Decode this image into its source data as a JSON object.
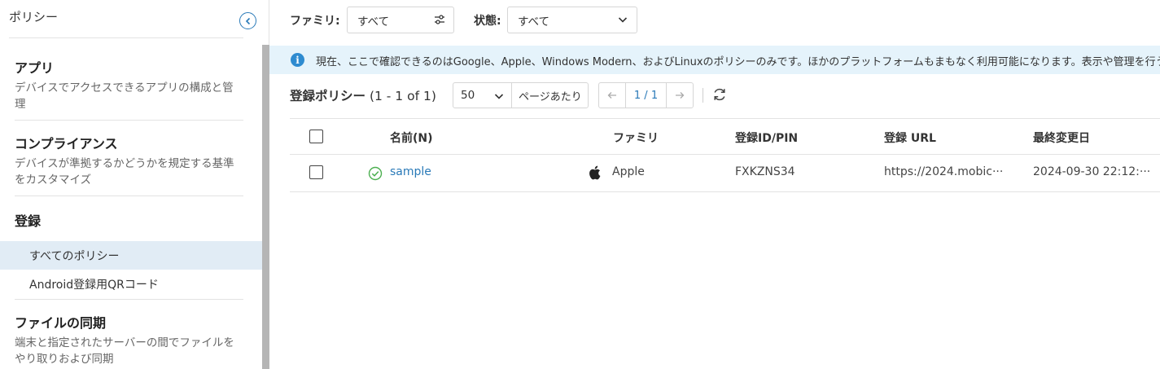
{
  "sidebar": {
    "title": "ポリシー",
    "sections": [
      {
        "title": "アプリ",
        "desc_line1": "デバイスでアクセスできるアプリの構成と管",
        "desc_line2": "理"
      },
      {
        "title": "コンプライアンス",
        "desc_line1": "デバイスが準拠するかどうかを規定する基準",
        "desc_line2": "をカスタマイズ"
      },
      {
        "title": "登録"
      },
      {
        "title": "ファイルの同期",
        "desc_line1": "端末と指定されたサーバーの間でファイルを",
        "desc_line2": "やり取りおよび同期"
      }
    ],
    "nav_items": [
      {
        "label": "すべてのポリシー",
        "active": true
      },
      {
        "label": "Android登録用QRコード",
        "active": false
      }
    ]
  },
  "filters": {
    "family_label": "ファミリ:",
    "family_value": "すべて",
    "state_label": "状態:",
    "state_value": "すべて"
  },
  "info_banner": {
    "text": "現在、ここで確認できるのはGoogle、Apple、Windows Modern、およびLinuxのポリシーのみです。ほかのプラットフォームもまもなく利用可能になります。表示や管理を行う"
  },
  "toolbar": {
    "title": "登録ポリシー",
    "count": "(1 - 1 of 1)",
    "per_page_value": "50",
    "per_page_label": "ページあたり",
    "page": "1 / 1"
  },
  "table": {
    "headers": {
      "name": "名前(N)",
      "family": "ファミリ",
      "id_pin": "登録ID/PIN",
      "url": "登録 URL",
      "modified": "最終変更日"
    },
    "rows": [
      {
        "name": "sample",
        "family": "Apple",
        "id_pin": "FXKZNS34",
        "url": "https://2024.mobic···",
        "modified": "2024-09-30 22:12:···"
      }
    ]
  },
  "colors": {
    "accent": "#2a7ab8",
    "active_nav_bg": "#e1ecf5",
    "info_bg": "#e5f3fb",
    "status_ok": "#4caf50"
  }
}
